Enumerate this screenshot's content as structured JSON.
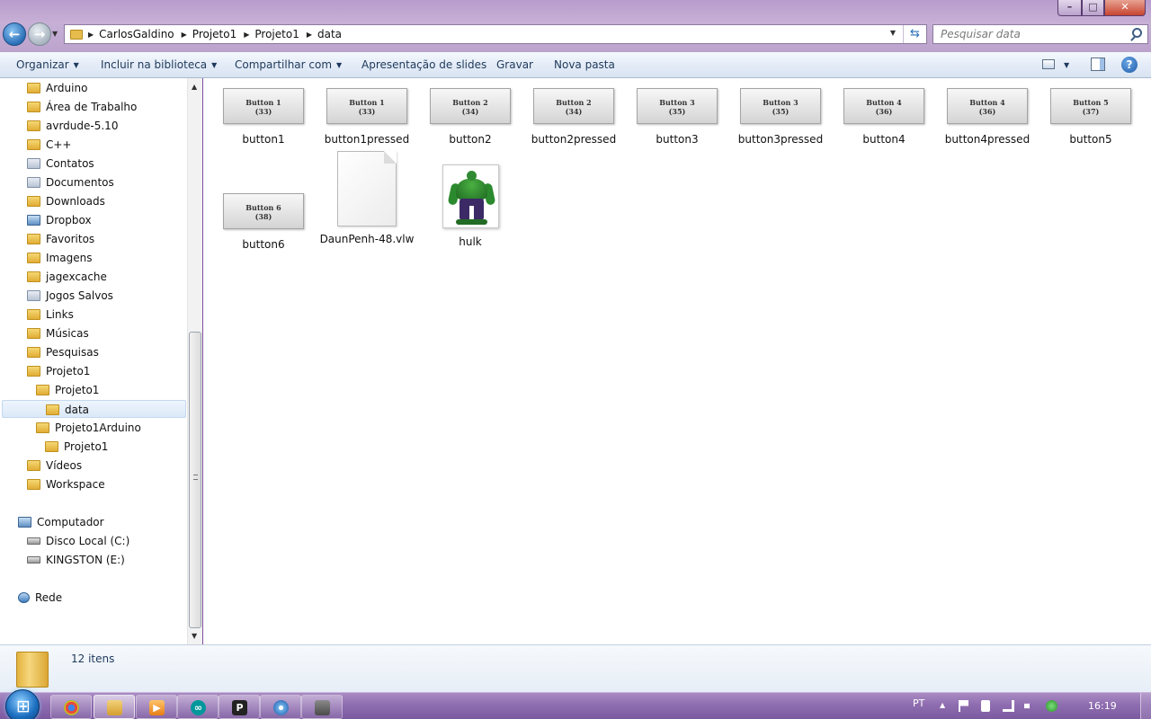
{
  "window": {
    "minimize_label": "–",
    "maximize_label": "□",
    "close_label": "✕"
  },
  "nav": {
    "back_icon": "back-arrow-icon",
    "forward_icon": "forward-arrow-icon"
  },
  "address": {
    "crumbs": [
      "CarlosGaldino",
      "Projeto1",
      "Projeto1",
      "data"
    ]
  },
  "search": {
    "placeholder": "Pesquisar data"
  },
  "commands": {
    "organizar": "Organizar",
    "incluir": "Incluir na biblioteca",
    "compartilhar": "Compartilhar com",
    "apresentacao": "Apresentação de slides",
    "gravar": "Gravar",
    "nova_pasta": "Nova pasta",
    "help": "?"
  },
  "sidebar": {
    "items": [
      {
        "label": "Arduino"
      },
      {
        "label": "Área de Trabalho"
      },
      {
        "label": "avrdude-5.10"
      },
      {
        "label": "C++"
      },
      {
        "label": "Contatos"
      },
      {
        "label": "Documentos"
      },
      {
        "label": "Downloads"
      },
      {
        "label": "Dropbox"
      },
      {
        "label": "Favoritos"
      },
      {
        "label": "Imagens"
      },
      {
        "label": "jagexcache"
      },
      {
        "label": "Jogos Salvos"
      },
      {
        "label": "Links"
      },
      {
        "label": "Músicas"
      },
      {
        "label": "Pesquisas"
      },
      {
        "label": "Projeto1"
      },
      {
        "label": "Projeto1"
      },
      {
        "label": "data"
      },
      {
        "label": "Projeto1Arduino"
      },
      {
        "label": "Projeto1"
      },
      {
        "label": "Vídeos"
      },
      {
        "label": "Workspace"
      }
    ],
    "computer": "Computador",
    "drive_c": "Disco Local (C:)",
    "drive_e": "KINGSTON (E:)",
    "network": "Rede"
  },
  "files": [
    {
      "name": "button1",
      "thumb_line1": "Button 1",
      "thumb_line2": "(33)"
    },
    {
      "name": "button1pressed",
      "thumb_line1": "Button 1",
      "thumb_line2": "(33)"
    },
    {
      "name": "button2",
      "thumb_line1": "Button 2",
      "thumb_line2": "(34)"
    },
    {
      "name": "button2pressed",
      "thumb_line1": "Button 2",
      "thumb_line2": "(34)"
    },
    {
      "name": "button3",
      "thumb_line1": "Button 3",
      "thumb_line2": "(35)"
    },
    {
      "name": "button3pressed",
      "thumb_line1": "Button 3",
      "thumb_line2": "(35)"
    },
    {
      "name": "button4",
      "thumb_line1": "Button 4",
      "thumb_line2": "(36)"
    },
    {
      "name": "button4pressed",
      "thumb_line1": "Button 4",
      "thumb_line2": "(36)"
    },
    {
      "name": "button5",
      "thumb_line1": "Button 5",
      "thumb_line2": "(37)"
    },
    {
      "name": "button6",
      "thumb_line1": "Button 6",
      "thumb_line2": "(38)"
    },
    {
      "name": "DaunPenh-48.vlw"
    },
    {
      "name": "hulk"
    }
  ],
  "status": {
    "item_count": "12 itens"
  },
  "taskbar": {
    "language": "PT",
    "time": "16:19",
    "apps": [
      "chrome-icon",
      "explorer-icon",
      "media-player-icon",
      "arduino-icon",
      "p-app-icon",
      "paint-icon",
      "app-icon"
    ],
    "p_label": "P",
    "arduino_label": "∞"
  }
}
